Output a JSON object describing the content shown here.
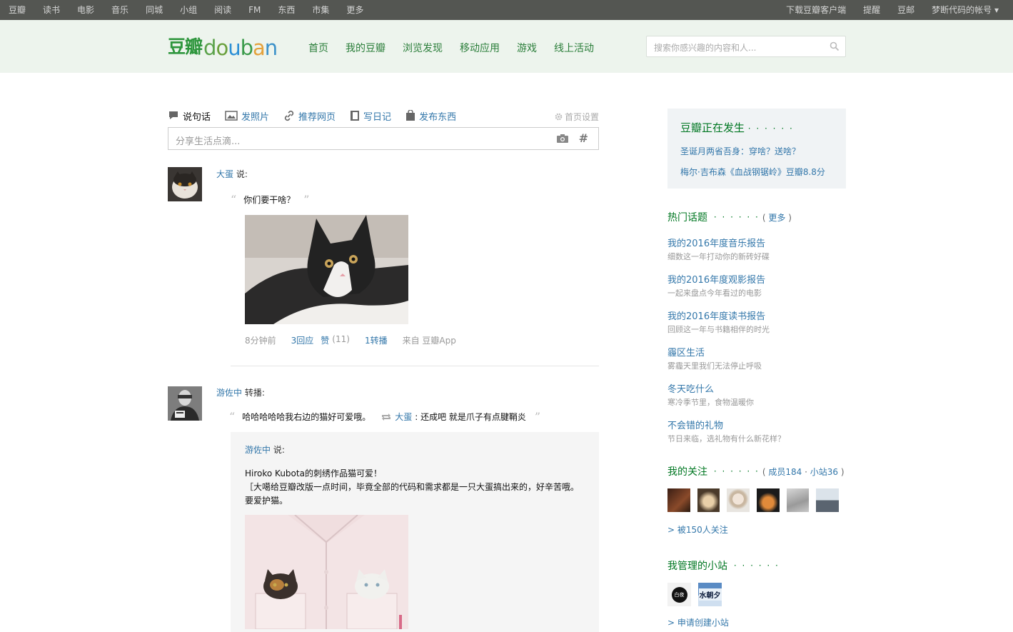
{
  "topbar": {
    "left": [
      "豆瓣",
      "读书",
      "电影",
      "音乐",
      "同城",
      "小组",
      "阅读",
      "FM",
      "东西",
      "市集",
      "更多"
    ],
    "right": [
      "下载豆瓣客户端",
      "提醒",
      "豆邮",
      "梦断代码的帐号 ▾"
    ]
  },
  "header": {
    "logo_cn": "豆瓣",
    "logo_en": [
      "d",
      "o",
      "u",
      "b",
      "a",
      "n"
    ],
    "nav": [
      "首页",
      "我的豆瓣",
      "浏览发现",
      "移动应用",
      "游戏",
      "线上活动"
    ],
    "search_placeholder": "搜索你感兴趣的内容和人..."
  },
  "composer": {
    "tabs": [
      "说句话",
      "发照片",
      "推荐网页",
      "写日记",
      "发布东西"
    ],
    "settings": "首页设置",
    "placeholder": "分享生活点滴...",
    "hash": "#"
  },
  "feed": [
    {
      "user": "大蛋",
      "verb": " 说:",
      "text": "你们要干啥？",
      "time": "8分钟前",
      "replies": "3回应",
      "like": "赞",
      "like_count": "(11)",
      "reshares": "1转播",
      "source": "来自 豆瓣App"
    },
    {
      "user": "游佐中",
      "verb": " 转播:",
      "text": "哈哈哈哈哈我右边的猫好可爱哦。",
      "reshare_user": "大蛋",
      "reshare_text": ": 还成吧 就是爪子有点腱鞘炎",
      "orig_user": "游佐中",
      "orig_verb": " 说:",
      "orig_text_1": "Hiroko Kubota的刺绣作品猫可爱！",
      "orig_text_2": "［大噶给豆瓣改版一点时间，毕竟全部的代码和需求都是一只大蛋搞出来的，好辛苦哦。要爱护猫。"
    }
  ],
  "sidebar": {
    "happening_title": "豆瓣正在发生",
    "dots": "· · · · · ·",
    "happening_items": [
      "圣诞月两省吾身：穿啥？送啥？",
      "梅尔·吉布森《血战钢锯岭》豆瓣8.8分"
    ],
    "hot_title": "热门话题",
    "hot_more_open": "(",
    "hot_more": "更多",
    "hot_more_close": ")",
    "topics": [
      {
        "title": "我的2016年度音乐报告",
        "desc": "细数这一年打动你的新砖好碟"
      },
      {
        "title": "我的2016年度观影报告",
        "desc": "一起来盘点今年看过的电影"
      },
      {
        "title": "我的2016年度读书报告",
        "desc": "回顾这一年与书籍相伴的时光"
      },
      {
        "title": "霾区生活",
        "desc": "雾霾天里我们无法停止呼吸"
      },
      {
        "title": "冬天吃什么",
        "desc": "寒冷季节里，食物温暖你"
      },
      {
        "title": "不会错的礼物",
        "desc": "节日来临，选礼物有什么新花样？"
      }
    ],
    "follow_title": "我的关注",
    "follow_stats_open": "(",
    "follow_members": "成员184",
    "follow_sep": " · ",
    "follow_sites": "小站36",
    "follow_stats_close": ")",
    "followed_by": "> 被150人关注",
    "sites_title": "我管理的小站",
    "site_labels": [
      "白夜",
      "水朝夕"
    ],
    "create_site": "> 申请创建小站"
  },
  "colors": {
    "topbar": "#545652",
    "header": "#edf4ed",
    "green": "#2e963d",
    "link": "#37a"
  }
}
